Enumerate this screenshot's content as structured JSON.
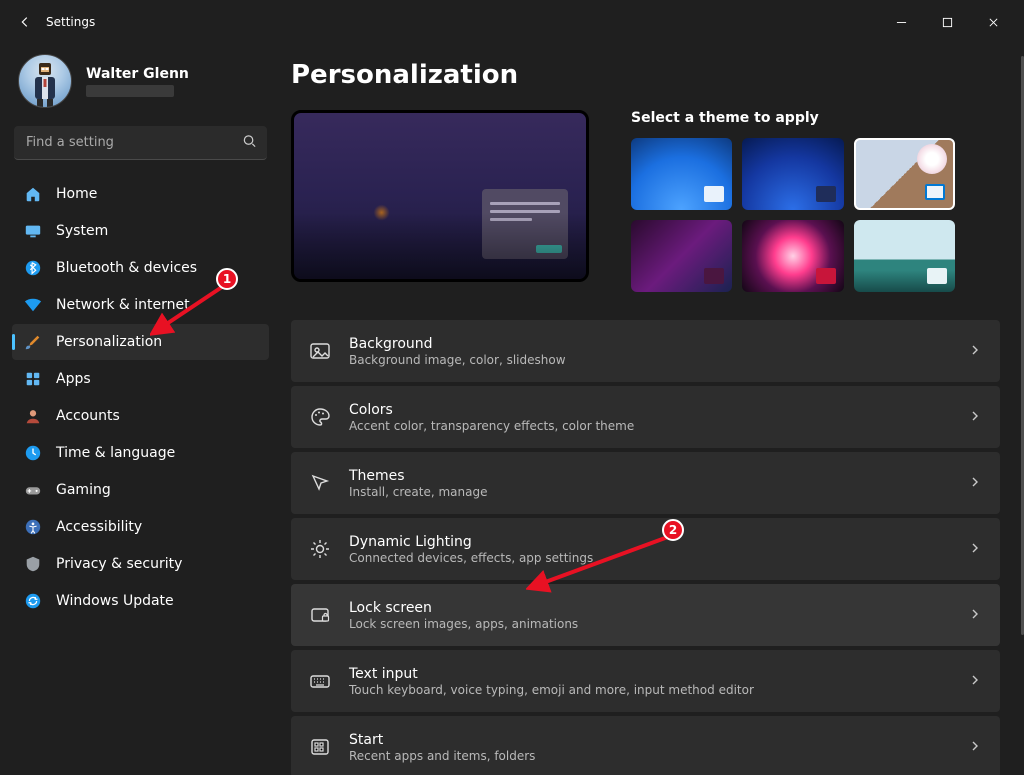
{
  "window": {
    "title": "Settings"
  },
  "user": {
    "name": "Walter Glenn"
  },
  "search": {
    "placeholder": "Find a setting"
  },
  "sidebar": {
    "items": [
      {
        "label": "Home",
        "icon": "home"
      },
      {
        "label": "System",
        "icon": "system"
      },
      {
        "label": "Bluetooth & devices",
        "icon": "bt"
      },
      {
        "label": "Network & internet",
        "icon": "wifi"
      },
      {
        "label": "Personalization",
        "icon": "brush",
        "selected": true
      },
      {
        "label": "Apps",
        "icon": "apps"
      },
      {
        "label": "Accounts",
        "icon": "account"
      },
      {
        "label": "Time & language",
        "icon": "time"
      },
      {
        "label": "Gaming",
        "icon": "gaming"
      },
      {
        "label": "Accessibility",
        "icon": "access"
      },
      {
        "label": "Privacy & security",
        "icon": "privacy"
      },
      {
        "label": "Windows Update",
        "icon": "update"
      }
    ]
  },
  "page": {
    "title": "Personalization",
    "themes_heading": "Select a theme to apply"
  },
  "rows": [
    {
      "title": "Background",
      "desc": "Background image, color, slideshow",
      "icon": "picture"
    },
    {
      "title": "Colors",
      "desc": "Accent color, transparency effects, color theme",
      "icon": "palette"
    },
    {
      "title": "Themes",
      "desc": "Install, create, manage",
      "icon": "themes"
    },
    {
      "title": "Dynamic Lighting",
      "desc": "Connected devices, effects, app settings",
      "icon": "light"
    },
    {
      "title": "Lock screen",
      "desc": "Lock screen images, apps, animations",
      "icon": "lock",
      "hl": true
    },
    {
      "title": "Text input",
      "desc": "Touch keyboard, voice typing, emoji and more, input method editor",
      "icon": "kb"
    },
    {
      "title": "Start",
      "desc": "Recent apps and items, folders",
      "icon": "start"
    }
  ],
  "annotations": {
    "marker1": "1",
    "marker2": "2"
  }
}
